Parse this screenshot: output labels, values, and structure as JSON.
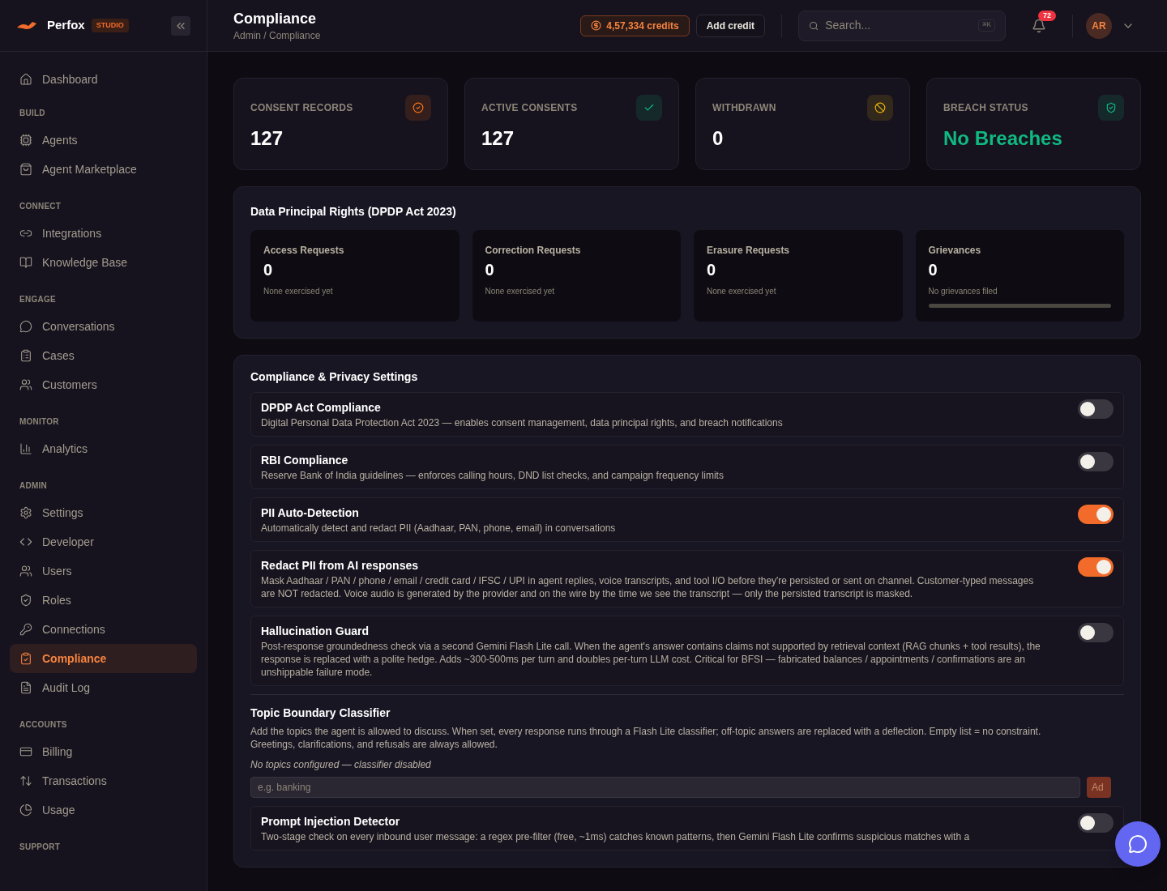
{
  "brand": {
    "name": "Perfox",
    "badge": "STUDIO"
  },
  "sidebar": {
    "sections": [
      {
        "items": [
          {
            "label": "Dashboard",
            "selected": false
          }
        ]
      },
      {
        "heading": "BUILD",
        "items": [
          {
            "label": "Agents",
            "selected": false
          },
          {
            "label": "Agent Marketplace",
            "selected": false
          }
        ]
      },
      {
        "heading": "CONNECT",
        "items": [
          {
            "label": "Integrations",
            "selected": false
          },
          {
            "label": "Knowledge Base",
            "selected": false
          }
        ]
      },
      {
        "heading": "ENGAGE",
        "items": [
          {
            "label": "Conversations",
            "selected": false
          },
          {
            "label": "Cases",
            "selected": false
          },
          {
            "label": "Customers",
            "selected": false
          }
        ]
      },
      {
        "heading": "MONITOR",
        "items": [
          {
            "label": "Analytics",
            "selected": false
          }
        ]
      },
      {
        "heading": "ADMIN",
        "items": [
          {
            "label": "Settings",
            "selected": false
          },
          {
            "label": "Developer",
            "selected": false
          },
          {
            "label": "Users",
            "selected": false
          },
          {
            "label": "Roles",
            "selected": false
          },
          {
            "label": "Connections",
            "selected": false
          },
          {
            "label": "Compliance",
            "selected": true
          },
          {
            "label": "Audit Log",
            "selected": false
          }
        ]
      },
      {
        "heading": "ACCOUNTS",
        "items": [
          {
            "label": "Billing",
            "selected": false
          },
          {
            "label": "Transactions",
            "selected": false
          },
          {
            "label": "Usage",
            "selected": false
          }
        ]
      },
      {
        "heading": "SUPPORT"
      }
    ]
  },
  "header": {
    "title": "Compliance",
    "breadcrumb": "Admin / Compliance",
    "credits": "4,57,334 credits",
    "add_credit": "Add credit",
    "search_placeholder": "Search...",
    "shortcut": "⌘K",
    "notifications": "72",
    "avatar": "AR"
  },
  "stats": [
    {
      "label": "CONSENT RECORDS",
      "value": "127",
      "color": "#f97316"
    },
    {
      "label": "ACTIVE CONSENTS",
      "value": "127",
      "color": "#10b981"
    },
    {
      "label": "WITHDRAWN",
      "value": "0",
      "color": "#eab308"
    },
    {
      "label": "BREACH STATUS",
      "value": "No Breaches",
      "color": "#10b981"
    }
  ],
  "rights": {
    "title": "Data Principal Rights (DPDP Act 2023)",
    "cards": [
      {
        "title": "Access Requests",
        "value": "0",
        "note": "None exercised yet"
      },
      {
        "title": "Correction Requests",
        "value": "0",
        "note": "None exercised yet"
      },
      {
        "title": "Erasure Requests",
        "value": "0",
        "note": "None exercised yet"
      },
      {
        "title": "Grievances",
        "value": "0",
        "note": "No grievances filed",
        "level": 0
      }
    ]
  },
  "settings": {
    "title": "Compliance & Privacy Settings",
    "items": [
      {
        "kind": "toggle",
        "title": "DPDP Act Compliance",
        "description": "Digital Personal Data Protection Act 2023 — enables consent management, data principal rights, and breach notifications",
        "on": false
      },
      {
        "kind": "toggle",
        "title": "RBI Compliance",
        "description": "Reserve Bank of India guidelines — enforces calling hours, DND list checks, and campaign frequency limits",
        "on": false
      },
      {
        "kind": "toggle",
        "title": "PII Auto-Detection",
        "description": "Automatically detect and redact PII (Aadhaar, PAN, phone, email) in conversations",
        "on": true
      },
      {
        "kind": "toggle",
        "title": "Redact PII from AI responses",
        "description": "Mask Aadhaar / PAN / phone / email / credit card / IFSC / UPI in agent replies, voice transcripts, and tool I/O before they're persisted or sent on channel. Customer-typed messages are NOT redacted. Voice audio is generated by the provider and on the wire by the time we see the transcript — only the persisted transcript is masked.",
        "on": true
      },
      {
        "kind": "toggle",
        "title": "Hallucination Guard",
        "description": "Post-response groundedness check via a second Gemini Flash Lite call. When the agent's answer contains claims not supported by retrieval context (RAG chunks + tool results), the response is replaced with a polite hedge. Adds ~300-500ms per turn and doubles per-turn LLM cost. Critical for BFSI — fabricated balances / appointments / confirmations are an unshippable failure mode.",
        "on": false
      },
      {
        "kind": "topics",
        "title": "Topic Boundary Classifier",
        "description": "Add the topics the agent is allowed to discuss. When set, every response runs through a Flash Lite classifier; off-topic answers are replaced with a deflection. Empty list = no constraint. Greetings, clarifications, and refusals are always allowed.",
        "status": "No topics configured — classifier disabled",
        "placeholder": "e.g. banking",
        "button": "Ad"
      },
      {
        "kind": "toggle",
        "title": "Prompt Injection Detector",
        "description": "Two-stage check on every inbound user message: a regex pre-filter (free, ~1ms) catches known patterns, then Gemini Flash Lite confirms suspicious matches with a",
        "on": false
      }
    ]
  }
}
